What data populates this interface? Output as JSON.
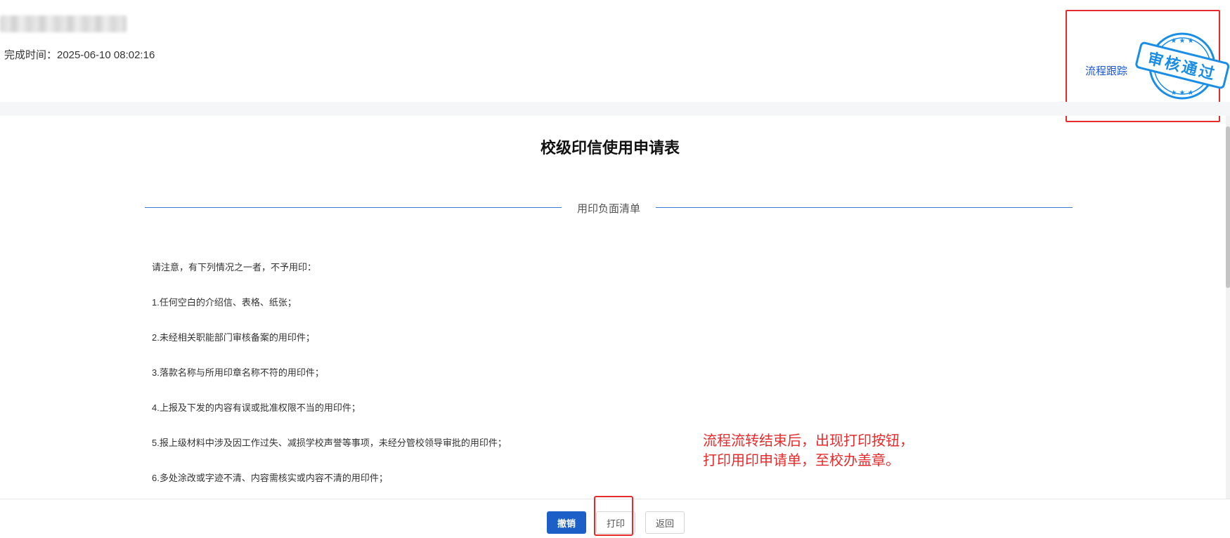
{
  "header": {
    "finish_time_label": "完成时间：2025-06-10 08:02:16",
    "track_link_label": "流程跟踪",
    "stamp_text": "审核通过"
  },
  "form": {
    "title": "校级印信使用申请表",
    "section_label": "用印负面清单",
    "notice_items": [
      "请注意，有下列情况之一者，不予用印：",
      "1.任何空白的介绍信、表格、纸张；",
      "2.未经相关职能部门审核备案的用印件；",
      "3.落款名称与所用印章名称不符的用印件；",
      "4.上报及下发的内容有误或批准权限不当的用印件；",
      "5.报上级材料中涉及因工作过失、减损学校声誉等事项，未经分管校领导审批的用印件；",
      "6.多处涂改或字迹不清、内容需核实或内容不清的用印件；"
    ]
  },
  "annotation": {
    "line1": "流程流转结束后，出现打印按钮，",
    "line2": "打印用印申请单，至校办盖章。"
  },
  "footer": {
    "revoke_label": "撤销",
    "print_label": "打印",
    "back_label": "返回"
  },
  "colors": {
    "primary_blue": "#1c5fc7",
    "link_blue": "#1a57d6",
    "stamp_blue": "#1a8ee6",
    "highlight_red": "#e52b2b"
  },
  "icons": {
    "stamp": "approved-seal-icon"
  }
}
